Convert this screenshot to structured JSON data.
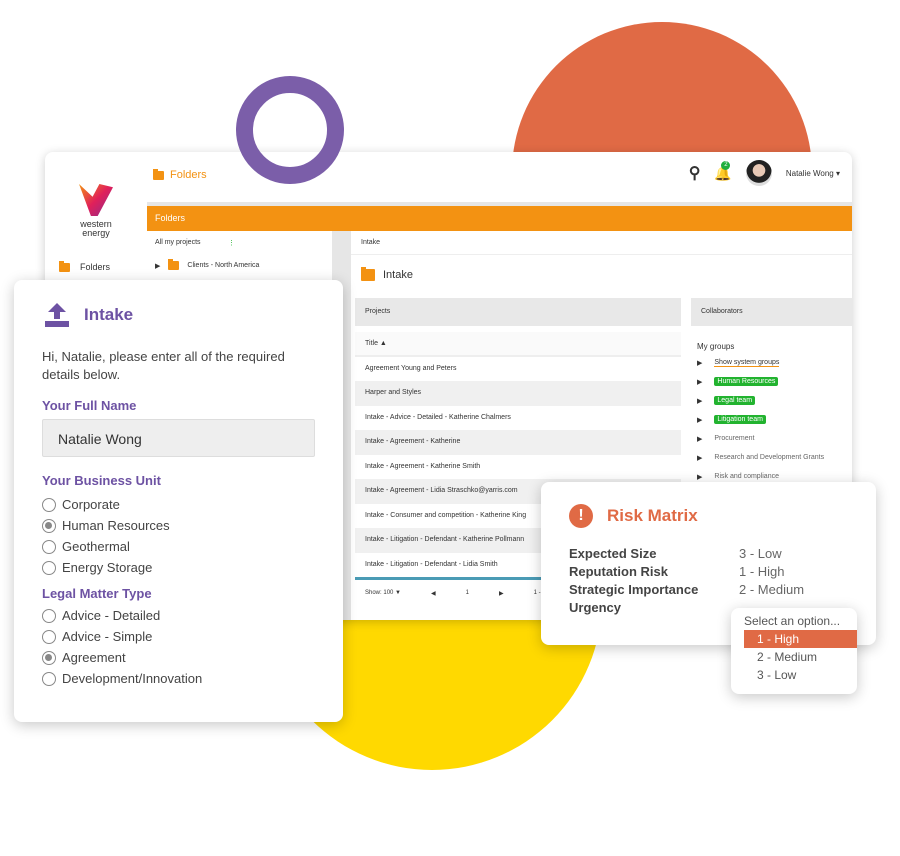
{
  "brand": {
    "line1": "western",
    "line2": "energy"
  },
  "header": {
    "breadcrumb": "Folders",
    "notification_count": "2",
    "user_name": "Natalie Wong"
  },
  "sidebar": {
    "folders": "Folders"
  },
  "folders_bar": "Folders",
  "tree": {
    "title": "All my projects",
    "items": [
      "Clients - North America"
    ]
  },
  "main": {
    "breadcrumb": "Intake",
    "title": "Intake",
    "projects": {
      "header": "Projects",
      "column": "Title",
      "rows": [
        "Agreement Young and Peters",
        "Harper and Styles",
        "Intake - Advice - Detailed - Katherine Chalmers",
        "Intake - Agreement - Katherine",
        "Intake - Agreement - Katherine Smith",
        "Intake - Agreement - Lidia Straschko@yarris.com",
        "Intake - Consumer and competition - Katherine King",
        "Intake - Litigation - Defendant - Katherine Pollmann",
        "Intake - Litigation - Defendant - Lidia Smith"
      ],
      "show_label": "Show:",
      "show_value": "100",
      "page": "1",
      "range": "1 -"
    },
    "collaborators": {
      "header": "Collaborators",
      "my_groups": "My groups",
      "show_system": "Show system groups",
      "tags": [
        "Human Resources",
        "Legal team",
        "Litigation team"
      ],
      "groups": [
        "Procurement",
        "Research and Development Grants",
        "Risk and compliance"
      ]
    }
  },
  "intake": {
    "title": "Intake",
    "intro": "Hi, Natalie, please enter all of the required details below.",
    "name_label": "Your Full Name",
    "name_value": "Natalie Wong",
    "unit_label": "Your Business Unit",
    "units": [
      "Corporate",
      "Human Resources",
      "Geothermal",
      "Energy Storage"
    ],
    "unit_selected": "Human Resources",
    "type_label": "Legal Matter Type",
    "types": [
      "Advice - Detailed",
      "Advice - Simple",
      "Agreement",
      "Development/Innovation"
    ],
    "type_selected": "Agreement"
  },
  "risk": {
    "title": "Risk Matrix",
    "rows": [
      {
        "k": "Expected Size",
        "v": "3 - Low"
      },
      {
        "k": "Reputation Risk",
        "v": "1 - High"
      },
      {
        "k": "Strategic Importance",
        "v": "2 - Medium"
      },
      {
        "k": "Urgency",
        "v": ""
      }
    ],
    "dropdown": {
      "placeholder": "Select an option...",
      "options": [
        "1 - High",
        "2 - Medium",
        "3 - Low"
      ],
      "highlighted": "1 - High"
    }
  },
  "colors": {
    "purple": "#6d52a3",
    "orange": "#f39212",
    "risk": "#e06a45",
    "yellow": "#ffd900",
    "tag_green": "#22b32f"
  }
}
